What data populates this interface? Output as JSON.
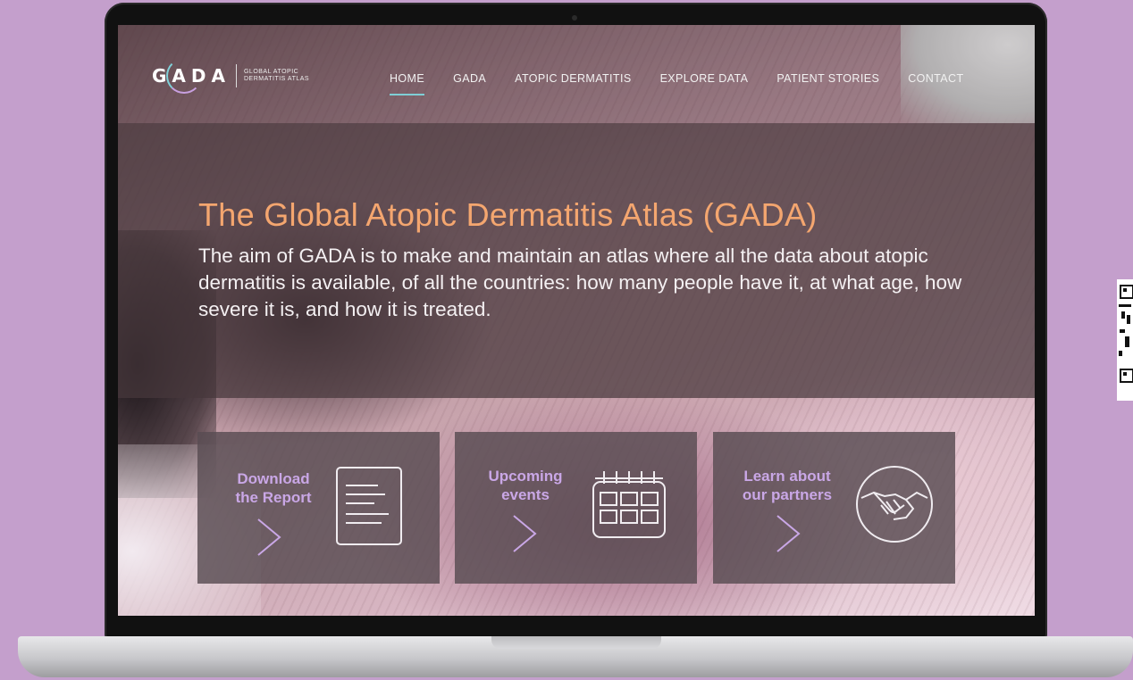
{
  "site": {
    "logo_text": "GADA",
    "logo_tagline": "GLOBAL ATOPIC DERMATITIS ATLAS"
  },
  "nav": {
    "items": [
      {
        "label": "HOME",
        "active": true
      },
      {
        "label": "GADA"
      },
      {
        "label": "ATOPIC DERMATITIS"
      },
      {
        "label": "EXPLORE DATA"
      },
      {
        "label": "PATIENT STORIES"
      },
      {
        "label": "CONTACT"
      }
    ]
  },
  "hero": {
    "title": "The Global Atopic Dermatitis Atlas (GADA)",
    "description": "The aim of GADA is to make and maintain an atlas where all the data about atopic dermatitis is available, of all the countries: how many people have it, at what age, how severe it is, and how it is treated."
  },
  "cards": [
    {
      "label_line1": "Download",
      "label_line2": "the Report",
      "icon": "document-icon"
    },
    {
      "label_line1": "Upcoming",
      "label_line2": "events",
      "icon": "calendar-icon"
    },
    {
      "label_line1": "Learn about",
      "label_line2": "our partners",
      "icon": "handshake-icon"
    }
  ],
  "colors": {
    "background": "#c49fcc",
    "title_accent": "#f4a66f",
    "card_text": "#c9a7e6",
    "nav_underline": "#7fcfd6"
  }
}
